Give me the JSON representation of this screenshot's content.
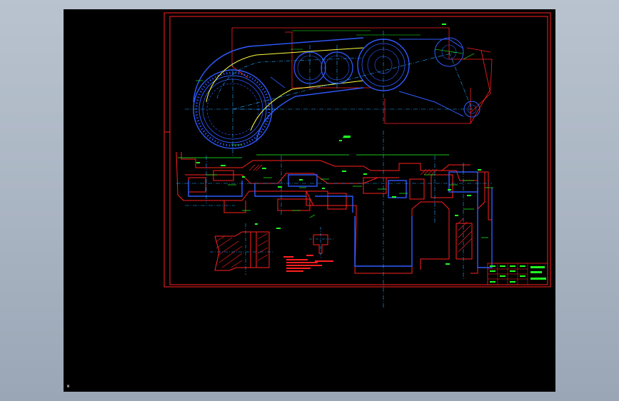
{
  "viewer": {
    "background": "#000000",
    "border_color": "#ff2020",
    "ucs_label": "W"
  },
  "colors": {
    "outline": "#ff2020",
    "contour": "#2f5bff",
    "centerline": "#26a8ff",
    "dimension": "#20ff20",
    "highlight": "#ffff40",
    "title_text": "#20ff20"
  }
}
